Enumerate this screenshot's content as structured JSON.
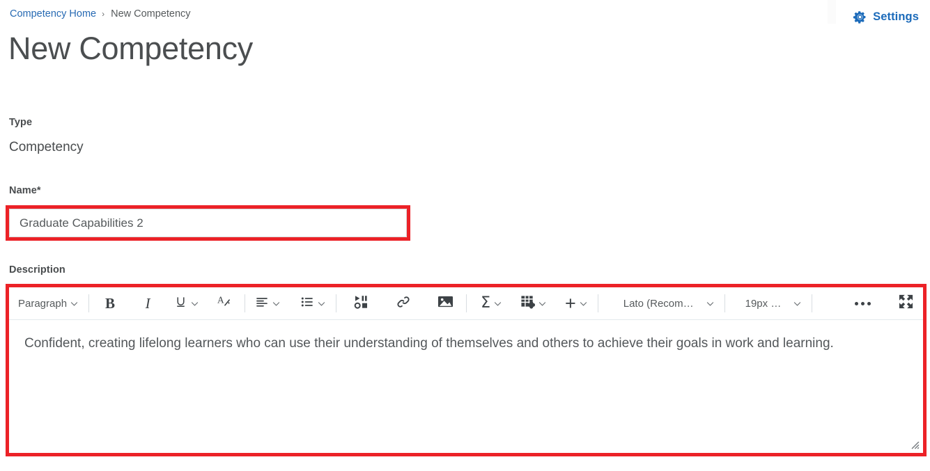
{
  "breadcrumb": {
    "home_label": "Competency Home",
    "separator": "›",
    "current_label": "New Competency"
  },
  "header": {
    "settings_label": "Settings",
    "title": "New Competency"
  },
  "form": {
    "type_label": "Type",
    "type_value": "Competency",
    "name_label": "Name",
    "name_required_marker": "*",
    "name_value": "Graduate Capabilities 2",
    "name_placeholder": "",
    "description_label": "Description"
  },
  "editor": {
    "toolbar": {
      "paragraph_style": "Paragraph",
      "bold": "B",
      "italic": "I",
      "underline": "U",
      "clear_formatting": "A",
      "align": "align-left",
      "lists": "bulleted-list",
      "media": "insert-media",
      "link": "insert-link",
      "image": "insert-image",
      "equation": "Σ",
      "table": "insert-table",
      "insert": "+",
      "font_family": "Lato (Recom…",
      "font_size": "19px …",
      "more_options": "…",
      "fullscreen": "fullscreen"
    },
    "content": "Confident, creating lifelong learners who can use their understanding of themselves and others to achieve their goals in work and learning."
  },
  "colors": {
    "link_blue": "#276ab3",
    "settings_blue": "#1c6bba",
    "highlight_red": "#ec2227",
    "text_gray": "#494c4e"
  }
}
